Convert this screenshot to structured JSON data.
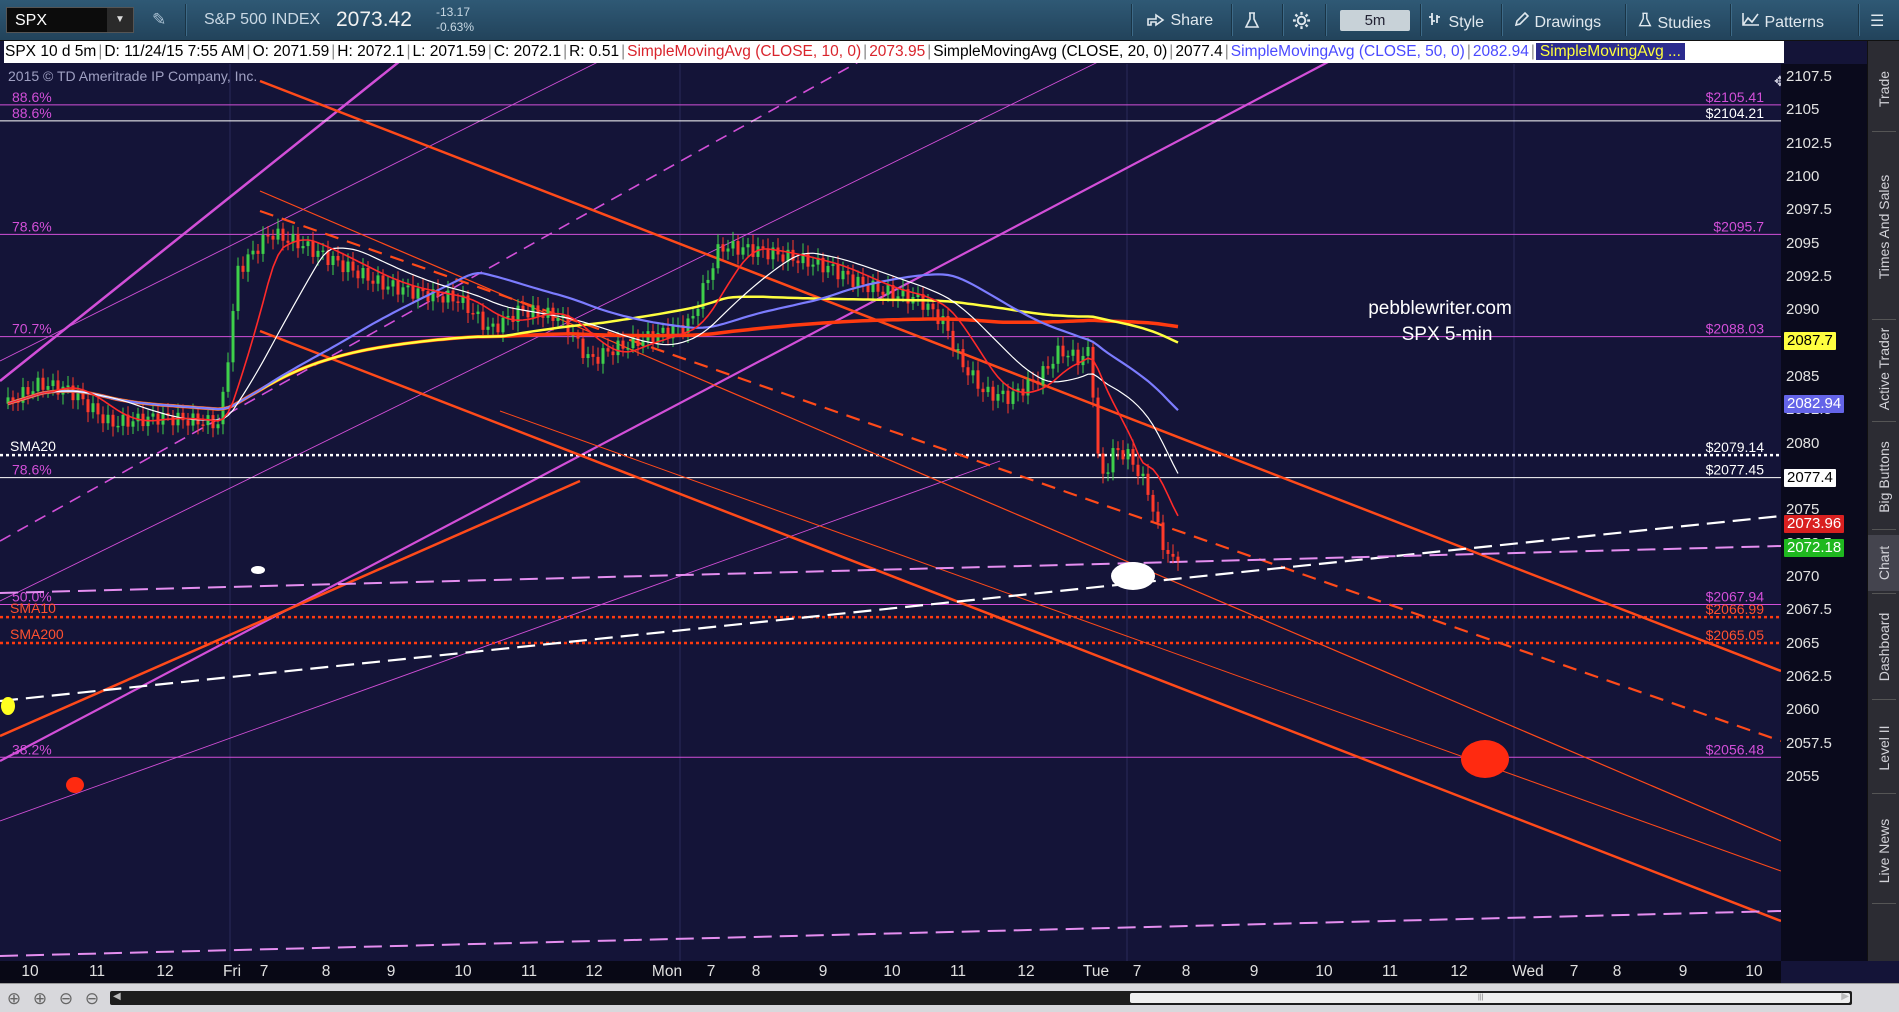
{
  "toolbar": {
    "symbol": "SPX",
    "dropdown_glyph": "▼",
    "pencil_glyph": "✎",
    "index_name": "S&P 500 INDEX",
    "last_price": "2073.42",
    "net_change": "-13.17",
    "pct_change": "-0.63%",
    "share_label": "Share",
    "interval": "5m",
    "style_label": "Style",
    "drawings_label": "Drawings",
    "studies_label": "Studies",
    "patterns_label": "Patterns",
    "menu_glyph": "☰"
  },
  "chart_header": {
    "desc": "SPX 10 d 5m",
    "date": "D: 11/24/15 7:55 AM",
    "open": "O: 2071.59",
    "high": "H: 2072.1",
    "low": "L: 2071.59",
    "close": "C: 2072.1",
    "range": "R: 0.51",
    "sma10_label": "SimpleMovingAvg (CLOSE, 10, 0)",
    "sma10_value": "2073.95",
    "sma20_label": "SimpleMovingAvg (CLOSE, 20, 0)",
    "sma20_value": "2077.4",
    "sma50_label": "SimpleMovingAvg (CLOSE, 50, 0)",
    "sma50_value": "2082.94",
    "sma200_label": "SimpleMovingAvg ..."
  },
  "copyright": "2015 © TD Ameritrade IP Company, Inc.",
  "watermark": [
    "pebblewriter.com",
    "SPX 5-min"
  ],
  "colors": {
    "background": "#141438",
    "fib": "#d24fd8",
    "channel": "#ff4a1a",
    "sma10": "#ff2a2a",
    "sma20": "#ffffff",
    "sma50": "#7c7cff",
    "sma100": "#ffff40",
    "sma200": "#ff3a10",
    "up_candle": "#3ed04a",
    "down_candle": "#ff3a2a"
  },
  "price_axis": {
    "ticks": [
      "2107.5",
      "2105",
      "2102.5",
      "2100",
      "2097.5",
      "2095",
      "2092.5",
      "2090",
      "2087.5",
      "2085",
      "2082.5",
      "2080",
      "2077.5",
      "2075",
      "2072.5",
      "2070",
      "2067.5",
      "2065",
      "2062.5",
      "2060",
      "2057.5",
      "2055"
    ],
    "badges": [
      {
        "value": "2087.7",
        "bg": "#ffff40",
        "fg": "#000000"
      },
      {
        "value": "2082.94",
        "bg": "#6464e8",
        "fg": "#ffffff"
      },
      {
        "value": "2077.4",
        "bg": "#ffffff",
        "fg": "#000000"
      },
      {
        "value": "2073.96",
        "bg": "#d92020",
        "fg": "#ffffff"
      },
      {
        "value": "2072.18",
        "bg": "#1fb81f",
        "fg": "#ffffff"
      }
    ]
  },
  "levels": [
    {
      "left": "88.6%",
      "right": "$2105.41",
      "price": 2105.41,
      "color": "#d24fd8"
    },
    {
      "left": "88.6%",
      "right": "$2104.21",
      "price": 2104.21,
      "color": "#ffffff"
    },
    {
      "left": "78.6%",
      "right": "$2095.7",
      "price": 2095.7,
      "color": "#d24fd8"
    },
    {
      "left": "70.7%",
      "right": "$2088.03",
      "price": 2088.03,
      "color": "#d24fd8"
    },
    {
      "left": "78.6%",
      "right": "$2077.45",
      "price": 2077.45,
      "color": "#ffffff"
    },
    {
      "left": "50.0%",
      "right": "$2067.94",
      "price": 2067.94,
      "color": "#d24fd8"
    },
    {
      "left": "38.2%",
      "right": "$2056.48",
      "price": 2056.48,
      "color": "#d24fd8"
    }
  ],
  "sma_lines": [
    {
      "left": "SMA20",
      "right": "$2079.14",
      "price": 2079.14,
      "color": "#ffffff"
    },
    {
      "left": "SMA10",
      "right": "$2066.99",
      "price": 2066.99,
      "color": "#ff3a10"
    },
    {
      "left": "SMA200",
      "right": "$2065.05",
      "price": 2065.05,
      "color": "#ff3a10"
    }
  ],
  "time_axis": [
    "10",
    "11",
    "12",
    "Fri",
    "7",
    "8",
    "9",
    "10",
    "11",
    "12",
    "Mon",
    "7",
    "8",
    "9",
    "10",
    "11",
    "12",
    "Tue",
    "7",
    "8",
    "9",
    "10",
    "11",
    "12",
    "Wed",
    "7",
    "8",
    "9",
    "10"
  ],
  "side_tabs": [
    "Trade",
    "Times And Sales",
    "Active Trader",
    "Big Buttons",
    "Chart",
    "Dashboard",
    "Level II",
    "Live News"
  ],
  "active_side_tab": "Chart",
  "bottom": {
    "zoom_glyphs": [
      "⊕",
      "⊕",
      "⊖",
      "⊖"
    ],
    "scroll_left": "◀",
    "scroll_right": "▶",
    "grip": "|||"
  }
}
